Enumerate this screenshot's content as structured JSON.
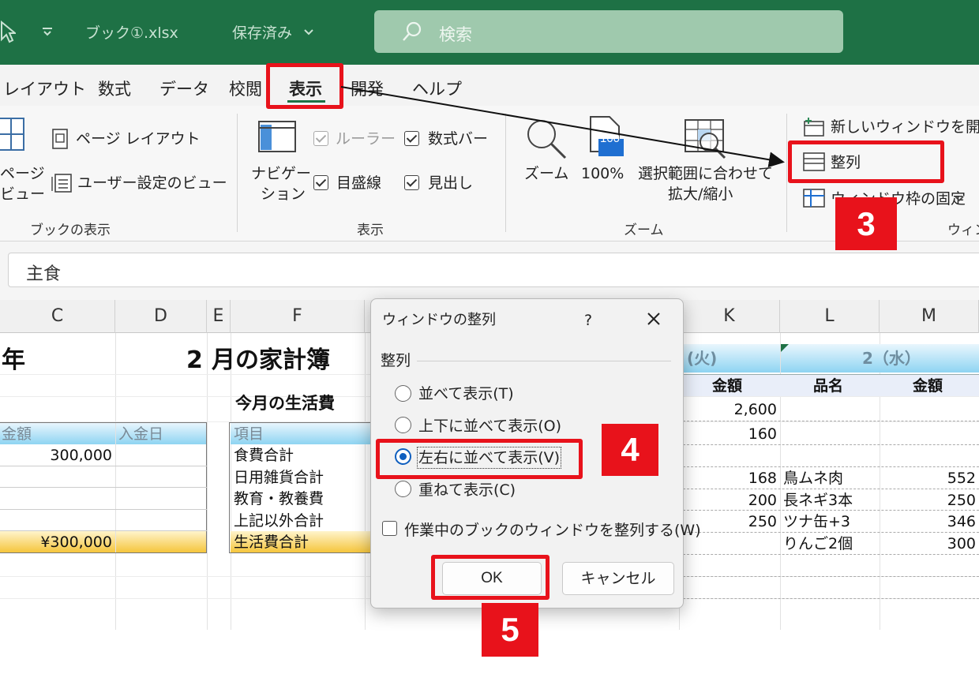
{
  "titlebar": {
    "filename": "ブック①.xlsx",
    "save_status": "保存済み",
    "search_placeholder": "検索"
  },
  "tabs": [
    "レイアウト",
    "数式",
    "データ",
    "校閲",
    "表示",
    "開発",
    "ヘルプ"
  ],
  "ribbon": {
    "book_view": {
      "page_label": "ページ",
      "view_label": "ビュー",
      "page_layout": "ページ レイアウト",
      "custom_views": "ユーザー設定のビュー",
      "group": "ブックの表示"
    },
    "show": {
      "navigation_1": "ナビゲー",
      "navigation_2": "ション",
      "ruler": "ルーラー",
      "formula_bar": "数式バー",
      "gridlines": "目盛線",
      "headings": "見出し",
      "group": "表示"
    },
    "zoom": {
      "zoom": "ズーム",
      "zoom100": "100%",
      "zoom100_icon": "100",
      "selection_1": "選択範囲に合わせて",
      "selection_2": "拡大/縮小",
      "group": "ズーム"
    },
    "window": {
      "new_window": "新しいウィンドウを開く",
      "arrange": "整列",
      "freeze": "ウィンドウ枠の固定",
      "group": "ウィン"
    }
  },
  "formula_bar": {
    "value": "主食"
  },
  "columns": [
    "C",
    "D",
    "E",
    "F",
    "K",
    "L",
    "M"
  ],
  "sheet": {
    "year_suffix": "年",
    "month_number": "2",
    "month_title": "月の家計簿",
    "living_title": "今月の生活費",
    "income_headers": [
      "金額",
      "入金日"
    ],
    "income_amount": "300,000",
    "income_total": "¥300,000",
    "items_header": "項目",
    "items": [
      "食費合計",
      "日用雑貨合計",
      "教育・教養費",
      "上記以外合計",
      "生活費合計"
    ],
    "day_tue": "(火)",
    "day_wed": "2（水）",
    "k_header": "金額",
    "l_header": "品名",
    "m_header": "金額",
    "k_values": [
      "2,600",
      "160",
      "168",
      "200",
      "250"
    ],
    "l_values": [
      "鳥ムネ肉",
      "長ネギ3本",
      "ツナ缶+3",
      "りんご2個"
    ],
    "m_values": [
      "552",
      "250",
      "346",
      "300"
    ]
  },
  "dialog": {
    "title": "ウィンドウの整列",
    "help": "?",
    "section": "整列",
    "options": [
      "並べて表示(T)",
      "上下に並べて表示(O)",
      "左右に並べて表示(V)",
      "重ねて表示(C)"
    ],
    "selected": "左右に並べて表示(V)",
    "checkbox_label": "作業中のブックのウィンドウを整列する(W)",
    "ok": "OK",
    "cancel": "キャンセル"
  },
  "annotations": {
    "step3": "3",
    "step4": "4",
    "step5": "5"
  },
  "colors": {
    "excel_green": "#1e7145",
    "highlight_red": "#e8121b",
    "radio_blue": "#0f5fbf"
  }
}
